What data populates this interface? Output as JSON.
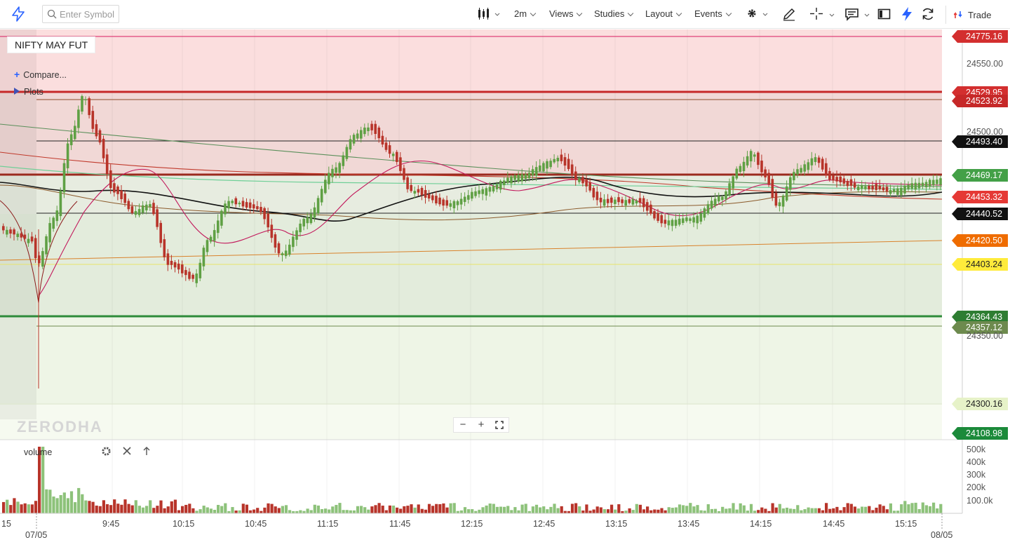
{
  "toolbar": {
    "search_placeholder": "Enter Symbol",
    "interval": "2m",
    "views": "Views",
    "studies": "Studies",
    "layout": "Layout",
    "events": "Events",
    "trade": "Trade"
  },
  "chart": {
    "symbol": "NIFTY MAY FUT",
    "compare_label": "Compare...",
    "plots_label": "Plots",
    "watermark": "ZERODHA",
    "volume_label": "volume"
  },
  "price_pills": [
    {
      "value": "24775.16",
      "color": "#d32f2f"
    },
    {
      "value": "24529.95",
      "color": "#d32f2f"
    },
    {
      "value": "24523.92",
      "color": "#c62828"
    },
    {
      "value": "24493.40",
      "color": "#111111"
    },
    {
      "value": "24469.17",
      "color": "#43a047"
    },
    {
      "value": "24453.32",
      "color": "#e53935"
    },
    {
      "value": "24440.52",
      "color": "#111111"
    },
    {
      "value": "24420.50",
      "color": "#ef6c00"
    },
    {
      "value": "24403.24",
      "color": "#ffeb3b"
    },
    {
      "value": "24364.43",
      "color": "#2e7d32"
    },
    {
      "value": "24357.12",
      "color": "#6d8a4e"
    },
    {
      "value": "24300.16",
      "color": "#e6f2c8"
    },
    {
      "value": "24108.98",
      "color": "#1b8a3a"
    }
  ],
  "y_ticks": [
    "24550.00",
    "24500.00",
    "24350.00"
  ],
  "volume_ticks": [
    "500k",
    "400k",
    "300k",
    "200k",
    "100.0k"
  ],
  "x_ticks": [
    "15",
    "9:45",
    "10:15",
    "10:45",
    "11:15",
    "11:45",
    "12:15",
    "12:45",
    "13:15",
    "13:45",
    "14:15",
    "14:45",
    "15:15"
  ],
  "x_dates": [
    "07/05",
    "08/05"
  ],
  "colors": {
    "up": "#5fa044",
    "down": "#b8342a",
    "resistance_zone": "#fbd9d9",
    "support_zone": "#e8f0df"
  }
}
